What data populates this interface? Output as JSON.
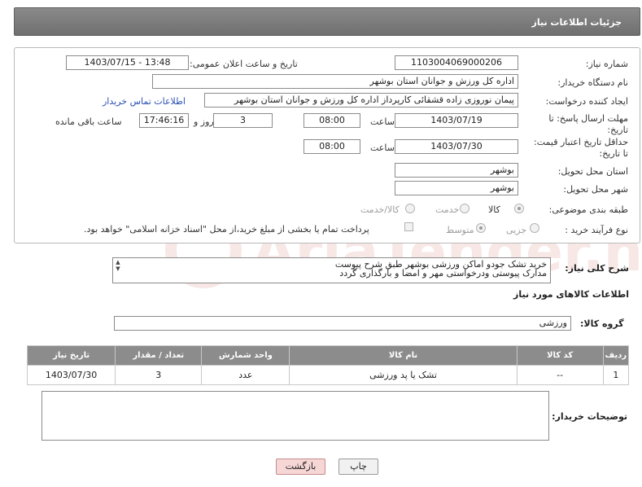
{
  "header": {
    "title": "جزئیات اطلاعات نیاز"
  },
  "form": {
    "need_number_label": "شماره نیاز:",
    "need_number": "1103004069000206",
    "announce_label": "تاریخ و ساعت اعلان عمومی:",
    "announce_value": "1403/07/15 - 13:48",
    "buyer_label": "نام دستگاه خریدار:",
    "buyer_value": "اداره کل ورزش و جوانان استان بوشهر",
    "creator_label": "ایجاد کننده درخواست:",
    "creator_value": "پیمان نوروزی زاده قشقائی کارپرداز اداره کل ورزش و جوانان استان بوشهر",
    "contact_link": "اطلاعات تماس خریدار",
    "deadline_label": "مهلت ارسال پاسخ: تا تاریخ:",
    "deadline_date": "1403/07/19",
    "time_label": "ساعت",
    "deadline_time": "08:00",
    "days_value": "3",
    "days_label": "روز و",
    "remaining_time": "17:46:16",
    "remaining_label": "ساعت باقی مانده",
    "validity_label": "حداقل تاریخ اعتبار قیمت: تا تاریخ:",
    "validity_date": "1403/07/30",
    "validity_time_label": "ساعت",
    "validity_time": "08:00",
    "province_label": "استان محل تحویل:",
    "province_value": "بوشهر",
    "city_label": "شهر محل تحویل:",
    "city_value": "بوشهر",
    "category_label": "طبقه بندی موضوعی:",
    "category_options": [
      "کالا",
      "خدمت",
      "کالا/خدمت"
    ],
    "process_label": "نوع فرآیند خرید :",
    "process_options": [
      "جزیی",
      "متوسط"
    ],
    "payment_note": "پرداخت تمام یا بخشی از مبلغ خرید،از محل \"اسناد خزانه اسلامی\" خواهد بود."
  },
  "description": {
    "label": "شرح کلی نیاز:",
    "line1": "خرید تشک جودو اماکن ورزشی بوشهر طبق شرح پیوست",
    "line2": "مدارک پیوستی ودرخواستی مهر و امضا و بارگذاری گردد"
  },
  "goods": {
    "section_title": "اطلاعات کالاهای مورد نیاز",
    "group_label": "گروه کالا:",
    "group_value": "ورزشی",
    "columns": [
      "ردیف",
      "کد کالا",
      "نام کالا",
      "واحد شمارش",
      "تعداد / مقدار",
      "تاریخ نیاز"
    ],
    "rows": [
      {
        "row": "1",
        "code": "--",
        "name": "تشک یا پد ورزشی",
        "unit": "عدد",
        "qty": "3",
        "date": "1403/07/30"
      }
    ]
  },
  "buyer_notes": {
    "label": "توضیحات خریدار:",
    "value": ""
  },
  "buttons": {
    "print": "چاپ",
    "back": "بازگشت"
  },
  "watermark": {
    "text": "AriaTender.neT"
  }
}
